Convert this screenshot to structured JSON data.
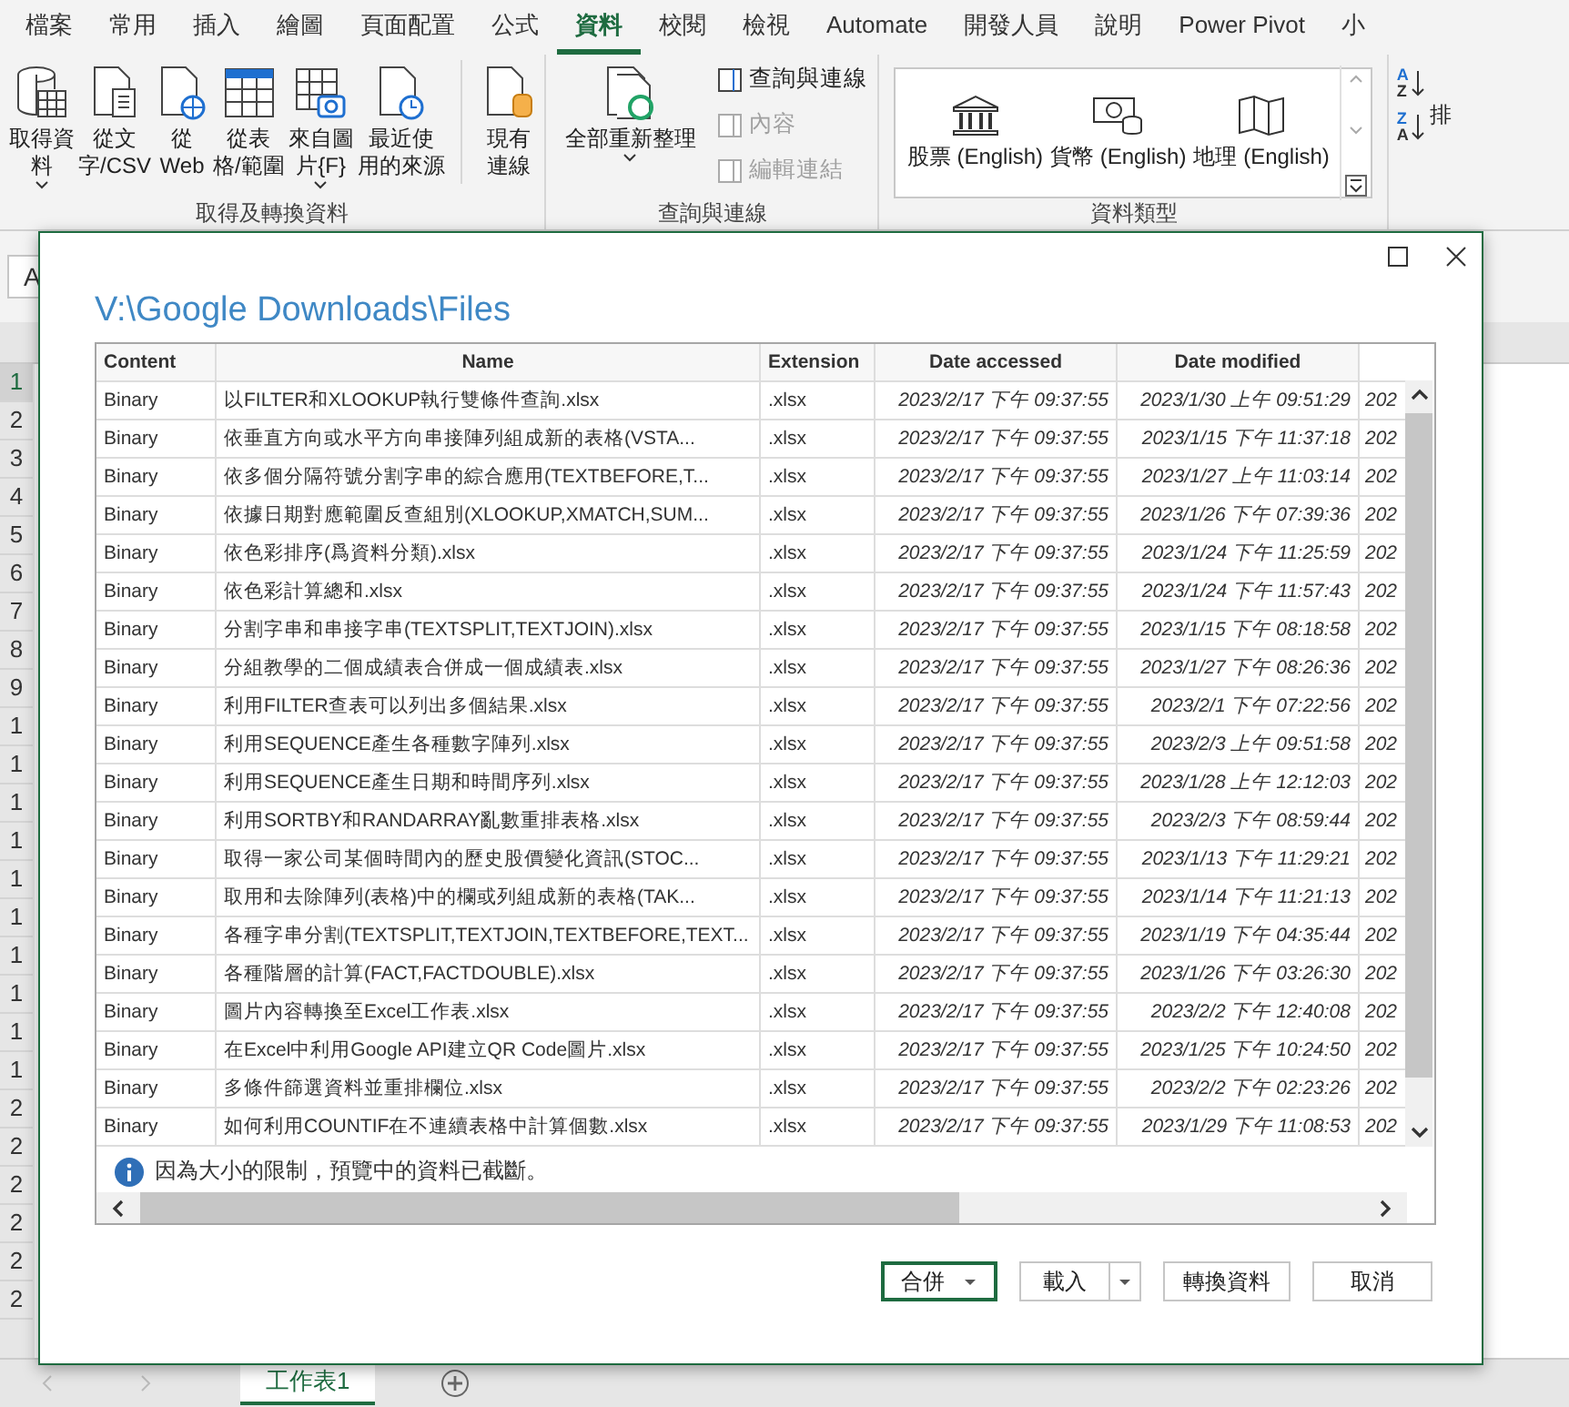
{
  "ribbon": {
    "tabs": [
      {
        "label": "檔案",
        "selected": false
      },
      {
        "label": "常用",
        "selected": false
      },
      {
        "label": "插入",
        "selected": false
      },
      {
        "label": "繪圖",
        "selected": false
      },
      {
        "label": "頁面配置",
        "selected": false
      },
      {
        "label": "公式",
        "selected": false
      },
      {
        "label": "資料",
        "selected": true
      },
      {
        "label": "校閱",
        "selected": false
      },
      {
        "label": "檢視",
        "selected": false
      },
      {
        "label": "Automate",
        "selected": false
      },
      {
        "label": "開發人員",
        "selected": false
      },
      {
        "label": "說明",
        "selected": false
      },
      {
        "label": "Power Pivot",
        "selected": false
      },
      {
        "label": "小",
        "selected": false
      }
    ],
    "groups": [
      {
        "title": "取得及轉換資料",
        "items": [
          {
            "kind": "large",
            "lines": [
              "取得資",
              "料"
            ],
            "dropdown": true
          },
          {
            "kind": "large",
            "lines": [
              "從文",
              "字/CSV"
            ],
            "dropdown": false
          },
          {
            "kind": "large",
            "lines": [
              "從",
              "Web"
            ],
            "dropdown": false
          },
          {
            "kind": "large",
            "lines": [
              "從表",
              "格/範圍"
            ],
            "dropdown": false
          },
          {
            "kind": "large",
            "lines": [
              "來自圖",
              "片{F}"
            ],
            "dropdown": true
          },
          {
            "kind": "large",
            "lines": [
              "最近使",
              "用的來源"
            ],
            "dropdown": false
          },
          {
            "kind": "large",
            "lines": [
              "現有",
              "連線"
            ],
            "dropdown": false
          }
        ]
      },
      {
        "title": "查詢與連線",
        "items": [
          {
            "kind": "large",
            "lines": [
              "全部重新整理"
            ],
            "dropdown": true
          },
          {
            "kind": "small",
            "label": "查詢與連線",
            "disabled": false
          },
          {
            "kind": "small",
            "label": "內容",
            "disabled": true
          },
          {
            "kind": "small",
            "label": "編輯連結",
            "disabled": true
          }
        ]
      },
      {
        "title": "資料類型",
        "items": [
          {
            "kind": "gallery",
            "label": "股票 (English)"
          },
          {
            "kind": "gallery",
            "label": "貨幣 (English)"
          },
          {
            "kind": "gallery",
            "label": "地理 (English)"
          }
        ]
      },
      {
        "items": [
          {
            "kind": "sort",
            "top": "A",
            "bottom": "Z"
          },
          {
            "kind": "sort",
            "top": "Z",
            "bottom": "A"
          },
          {
            "kind": "partial",
            "label": "排"
          }
        ]
      }
    ]
  },
  "name_box": "A",
  "row_headers": [
    {
      "label": "1",
      "selected": true
    },
    {
      "label": "2",
      "selected": false
    },
    {
      "label": "3",
      "selected": false
    },
    {
      "label": "4",
      "selected": false
    },
    {
      "label": "5",
      "selected": false
    },
    {
      "label": "6",
      "selected": false
    },
    {
      "label": "7",
      "selected": false
    },
    {
      "label": "8",
      "selected": false
    },
    {
      "label": "9",
      "selected": false
    },
    {
      "label": "1",
      "selected": false
    },
    {
      "label": "1",
      "selected": false
    },
    {
      "label": "1",
      "selected": false
    },
    {
      "label": "1",
      "selected": false
    },
    {
      "label": "1",
      "selected": false
    },
    {
      "label": "1",
      "selected": false
    },
    {
      "label": "1",
      "selected": false
    },
    {
      "label": "1",
      "selected": false
    },
    {
      "label": "1",
      "selected": false
    },
    {
      "label": "1",
      "selected": false
    },
    {
      "label": "2",
      "selected": false
    },
    {
      "label": "2",
      "selected": false
    },
    {
      "label": "2",
      "selected": false
    },
    {
      "label": "2",
      "selected": false
    },
    {
      "label": "2",
      "selected": false
    },
    {
      "label": "2",
      "selected": false
    }
  ],
  "sheet_tabs": [
    {
      "label": "工作表1",
      "selected": true
    }
  ],
  "dialog": {
    "title": "V:\\Google Downloads\\Files",
    "table": {
      "columns": [
        "Content",
        "Name",
        "Extension",
        "Date accessed",
        "Date modified",
        ""
      ],
      "rows": [
        {
          "content": "Binary",
          "name": "以FILTER和XLOOKUP執行雙條件查詢.xlsx",
          "extension": ".xlsx",
          "date_accessed": "2023/2/17 下午 09:37:55",
          "date_modified": "2023/1/30 上午 09:51:29",
          "column_6": "202"
        },
        {
          "content": "Binary",
          "name": "依垂直方向或水平方向串接陣列組成新的表格(VSTA...",
          "extension": ".xlsx",
          "date_accessed": "2023/2/17 下午 09:37:55",
          "date_modified": "2023/1/15 下午 11:37:18",
          "column_6": "202"
        },
        {
          "content": "Binary",
          "name": "依多個分隔符號分割字串的綜合應用(TEXTBEFORE,T...",
          "extension": ".xlsx",
          "date_accessed": "2023/2/17 下午 09:37:55",
          "date_modified": "2023/1/27 上午 11:03:14",
          "column_6": "202"
        },
        {
          "content": "Binary",
          "name": "依據日期對應範圍反查組別(XLOOKUP,XMATCH,SUM...",
          "extension": ".xlsx",
          "date_accessed": "2023/2/17 下午 09:37:55",
          "date_modified": "2023/1/26 下午 07:39:36",
          "column_6": "202"
        },
        {
          "content": "Binary",
          "name": "依色彩排序(爲資料分類).xlsx",
          "extension": ".xlsx",
          "date_accessed": "2023/2/17 下午 09:37:55",
          "date_modified": "2023/1/24 下午 11:25:59",
          "column_6": "202"
        },
        {
          "content": "Binary",
          "name": "依色彩計算總和.xlsx",
          "extension": ".xlsx",
          "date_accessed": "2023/2/17 下午 09:37:55",
          "date_modified": "2023/1/24 下午 11:57:43",
          "column_6": "202"
        },
        {
          "content": "Binary",
          "name": "分割字串和串接字串(TEXTSPLIT,TEXTJOIN).xlsx",
          "extension": ".xlsx",
          "date_accessed": "2023/2/17 下午 09:37:55",
          "date_modified": "2023/1/15 下午 08:18:58",
          "column_6": "202"
        },
        {
          "content": "Binary",
          "name": "分組教學的二個成績表合併成一個成績表.xlsx",
          "extension": ".xlsx",
          "date_accessed": "2023/2/17 下午 09:37:55",
          "date_modified": "2023/1/27 下午 08:26:36",
          "column_6": "202"
        },
        {
          "content": "Binary",
          "name": "利用FILTER查表可以列出多個結果.xlsx",
          "extension": ".xlsx",
          "date_accessed": "2023/2/17 下午 09:37:55",
          "date_modified": "2023/2/1 下午 07:22:56",
          "column_6": "202"
        },
        {
          "content": "Binary",
          "name": "利用SEQUENCE產生各種數字陣列.xlsx",
          "extension": ".xlsx",
          "date_accessed": "2023/2/17 下午 09:37:55",
          "date_modified": "2023/2/3 上午 09:51:58",
          "column_6": "202"
        },
        {
          "content": "Binary",
          "name": "利用SEQUENCE產生日期和時間序列.xlsx",
          "extension": ".xlsx",
          "date_accessed": "2023/2/17 下午 09:37:55",
          "date_modified": "2023/1/28 上午 12:12:03",
          "column_6": "202"
        },
        {
          "content": "Binary",
          "name": "利用SORTBY和RANDARRAY亂數重排表格.xlsx",
          "extension": ".xlsx",
          "date_accessed": "2023/2/17 下午 09:37:55",
          "date_modified": "2023/2/3 下午 08:59:44",
          "column_6": "202"
        },
        {
          "content": "Binary",
          "name": "取得一家公司某個時間內的歷史股價變化資訊(STOC...",
          "extension": ".xlsx",
          "date_accessed": "2023/2/17 下午 09:37:55",
          "date_modified": "2023/1/13 下午 11:29:21",
          "column_6": "202"
        },
        {
          "content": "Binary",
          "name": "取用和去除陣列(表格)中的欄或列組成新的表格(TAK...",
          "extension": ".xlsx",
          "date_accessed": "2023/2/17 下午 09:37:55",
          "date_modified": "2023/1/14 下午 11:21:13",
          "column_6": "202"
        },
        {
          "content": "Binary",
          "name": "各種字串分割(TEXTSPLIT,TEXTJOIN,TEXTBEFORE,TEXT...",
          "extension": ".xlsx",
          "date_accessed": "2023/2/17 下午 09:37:55",
          "date_modified": "2023/1/19 下午 04:35:44",
          "column_6": "202"
        },
        {
          "content": "Binary",
          "name": "各種階層的計算(FACT,FACTDOUBLE).xlsx",
          "extension": ".xlsx",
          "date_accessed": "2023/2/17 下午 09:37:55",
          "date_modified": "2023/1/26 下午 03:26:30",
          "column_6": "202"
        },
        {
          "content": "Binary",
          "name": "圖片內容轉換至Excel工作表.xlsx",
          "extension": ".xlsx",
          "date_accessed": "2023/2/17 下午 09:37:55",
          "date_modified": "2023/2/2 下午 12:40:08",
          "column_6": "202"
        },
        {
          "content": "Binary",
          "name": "在Excel中利用Google API建立QR Code圖片.xlsx",
          "extension": ".xlsx",
          "date_accessed": "2023/2/17 下午 09:37:55",
          "date_modified": "2023/1/25 下午 10:24:50",
          "column_6": "202"
        },
        {
          "content": "Binary",
          "name": "多條件篩選資料並重排欄位.xlsx",
          "extension": ".xlsx",
          "date_accessed": "2023/2/17 下午 09:37:55",
          "date_modified": "2023/2/2 下午 02:23:26",
          "column_6": "202"
        },
        {
          "content": "Binary",
          "name": "如何利用COUNTIF在不連續表格中計算個數.xlsx",
          "extension": ".xlsx",
          "date_accessed": "2023/2/17 下午 09:37:55",
          "date_modified": "2023/1/29 下午 11:08:53",
          "column_6": "202"
        }
      ]
    },
    "note": "因為大小的限制，預覽中的資料已截斷。",
    "buttons": [
      {
        "label": "合併",
        "kind": "dropdown",
        "primary": true
      },
      {
        "label": "載入",
        "kind": "split",
        "primary": false
      },
      {
        "label": "轉換資料",
        "kind": "plain",
        "primary": false
      },
      {
        "label": "取消",
        "kind": "plain",
        "primary": false
      }
    ]
  }
}
